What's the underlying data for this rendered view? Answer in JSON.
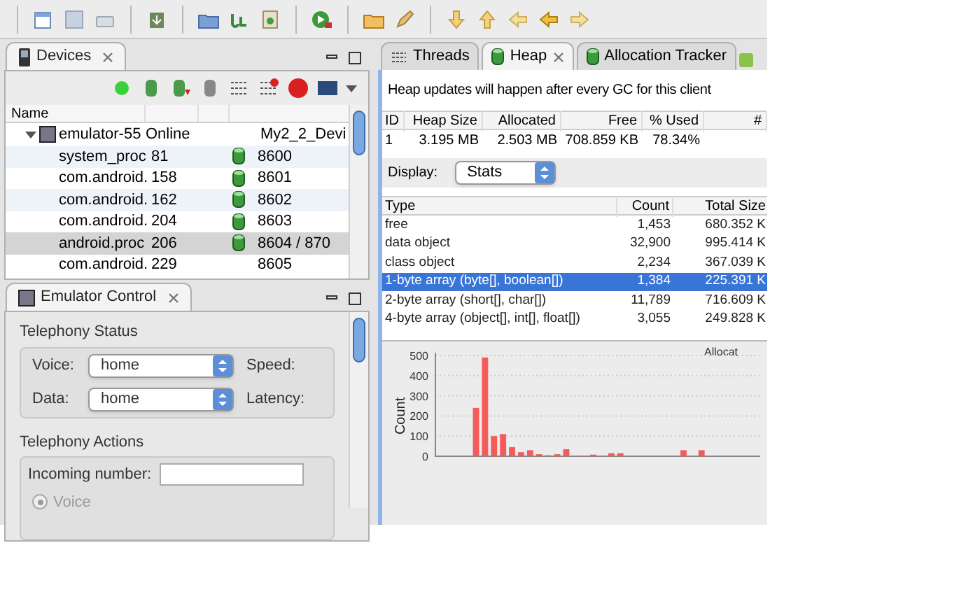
{
  "devices": {
    "title": "Devices",
    "columns": [
      "Name"
    ],
    "tree": [
      {
        "name": "emulator-55",
        "status": "Online",
        "info": "My2_2_Devi",
        "expanded": true,
        "children": [
          {
            "name": "system_proc",
            "pid": "81",
            "port": "8600",
            "tracked": true,
            "selected": false
          },
          {
            "name": "com.android.",
            "pid": "158",
            "port": "8601",
            "tracked": true,
            "selected": false
          },
          {
            "name": "com.android.",
            "pid": "162",
            "port": "8602",
            "tracked": true,
            "selected": false
          },
          {
            "name": "com.android.",
            "pid": "204",
            "port": "8603",
            "tracked": true,
            "selected": false
          },
          {
            "name": "android.proc",
            "pid": "206",
            "port": "8604 / 870",
            "tracked": true,
            "selected": true
          },
          {
            "name": "com.android.",
            "pid": "229",
            "port": "8605",
            "tracked": false,
            "selected": false
          }
        ]
      }
    ]
  },
  "emulator_control": {
    "title": "Emulator Control",
    "status_group": "Telephony Status",
    "voice": {
      "label": "Voice:",
      "value": "home"
    },
    "data": {
      "label": "Data:",
      "value": "home"
    },
    "speed_label": "Speed:",
    "latency_label": "Latency:",
    "actions_group": "Telephony Actions",
    "incoming_label": "Incoming number:",
    "radios": [
      {
        "label": "Voice",
        "selected": true,
        "disabled": true
      }
    ]
  },
  "tabs": [
    {
      "label": "Threads",
      "selected": false,
      "closable": false
    },
    {
      "label": "Heap",
      "selected": true,
      "closable": true
    },
    {
      "label": "Allocation Tracker",
      "selected": false,
      "closable": false
    }
  ],
  "heap": {
    "notice": "Heap updates will happen after every GC for this client",
    "columns": [
      "ID",
      "Heap Size",
      "Allocated",
      "Free",
      "% Used",
      "#"
    ],
    "row": [
      "1",
      "3.195 MB",
      "2.503 MB",
      "708.859 KB",
      "78.34%"
    ],
    "display": {
      "label": "Display:",
      "value": "Stats"
    },
    "type_columns": [
      "Type",
      "Count",
      "Total Size"
    ],
    "types": [
      {
        "type": "free",
        "count": "1,453",
        "size": "680.352 K",
        "selected": false
      },
      {
        "type": "data object",
        "count": "32,900",
        "size": "995.414 K",
        "selected": false
      },
      {
        "type": "class object",
        "count": "2,234",
        "size": "367.039 K",
        "selected": false
      },
      {
        "type": "1-byte array (byte[], boolean[])",
        "count": "1,384",
        "size": "225.391 K",
        "selected": true
      },
      {
        "type": "2-byte array (short[], char[])",
        "count": "11,789",
        "size": "716.609 K",
        "selected": false
      },
      {
        "type": "4-byte array (object[], int[], float[])",
        "count": "3,055",
        "size": "249.828 K",
        "selected": false
      }
    ],
    "chart_data": {
      "type": "bar",
      "title": "Allocat",
      "ylabel": "Count",
      "ylim": [
        0,
        500
      ],
      "yticks": [
        0,
        100,
        200,
        300,
        400,
        500
      ],
      "grid": true,
      "values": [
        0,
        0,
        0,
        0,
        240,
        490,
        100,
        110,
        45,
        20,
        30,
        10,
        5,
        10,
        35,
        3,
        3,
        8,
        0,
        15,
        15,
        0,
        0,
        0,
        0,
        0,
        0,
        30,
        0,
        30,
        0,
        0,
        3,
        3,
        0,
        0
      ]
    }
  }
}
